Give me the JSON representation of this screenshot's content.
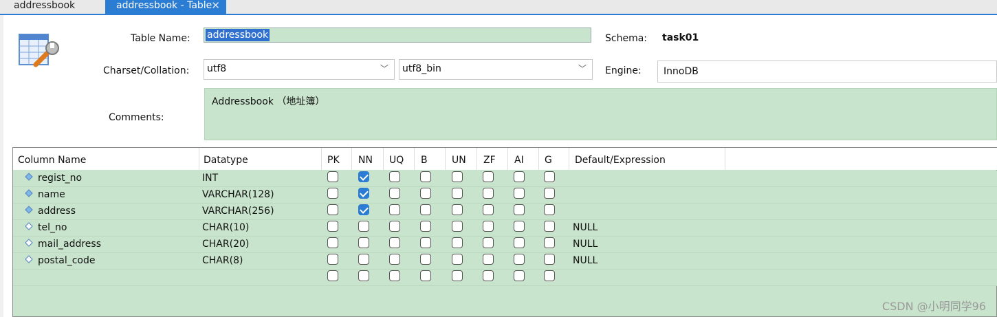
{
  "tabs": [
    {
      "label": "addressbook",
      "active": false
    },
    {
      "label": "addressbook - Table",
      "active": true
    }
  ],
  "form": {
    "table_name_label": "Table Name:",
    "table_name_value": "addressbook",
    "schema_label": "Schema:",
    "schema_value": "task01",
    "charset_label": "Charset/Collation:",
    "charset_value": "utf8",
    "collation_value": "utf8_bin",
    "engine_label": "Engine:",
    "engine_value": "InnoDB",
    "comments_label": "Comments:",
    "comments_value": "Addressbook （地址簿）"
  },
  "grid": {
    "headers": [
      "Column Name",
      "Datatype",
      "PK",
      "NN",
      "UQ",
      "B",
      "UN",
      "ZF",
      "AI",
      "G",
      "Default/Expression"
    ],
    "rows": [
      {
        "name": "regist_no",
        "datatype": "INT",
        "flags": [
          false,
          true,
          false,
          false,
          false,
          false,
          false,
          false
        ],
        "default": "",
        "filled": true
      },
      {
        "name": "name",
        "datatype": "VARCHAR(128)",
        "flags": [
          false,
          true,
          false,
          false,
          false,
          false,
          false,
          false
        ],
        "default": "",
        "filled": true
      },
      {
        "name": "address",
        "datatype": "VARCHAR(256)",
        "flags": [
          false,
          true,
          false,
          false,
          false,
          false,
          false,
          false
        ],
        "default": "",
        "filled": true
      },
      {
        "name": "tel_no",
        "datatype": "CHAR(10)",
        "flags": [
          false,
          false,
          false,
          false,
          false,
          false,
          false,
          false
        ],
        "default": "NULL",
        "filled": false
      },
      {
        "name": "mail_address",
        "datatype": "CHAR(20)",
        "flags": [
          false,
          false,
          false,
          false,
          false,
          false,
          false,
          false
        ],
        "default": "NULL",
        "filled": false
      },
      {
        "name": "postal_code",
        "datatype": "CHAR(8)",
        "flags": [
          false,
          false,
          false,
          false,
          false,
          false,
          false,
          false
        ],
        "default": "NULL",
        "filled": false
      },
      {
        "name": "",
        "datatype": "",
        "flags": [
          false,
          false,
          false,
          false,
          false,
          false,
          false,
          false
        ],
        "default": "",
        "filled": false
      }
    ]
  },
  "watermark": "CSDN @小明同学96",
  "colors": {
    "accent": "#2b7cd3",
    "field_bg": "#c9e4cc"
  },
  "icons": {
    "logo": "table-wrench-icon",
    "tab_close": "close-icon",
    "chevron": "chevron-down-icon",
    "column": "diamond-icon"
  }
}
